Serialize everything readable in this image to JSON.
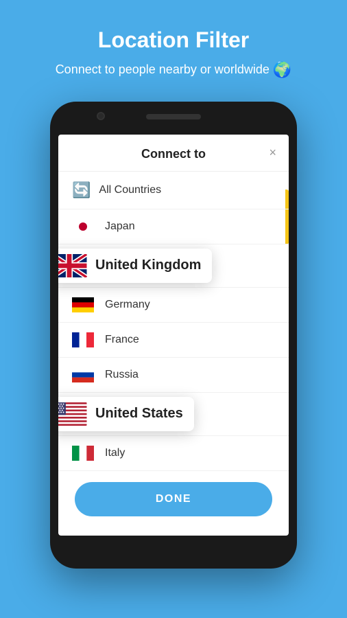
{
  "header": {
    "title": "Location Filter",
    "subtitle": "Connect to people nearby or\nworldwide",
    "globe_icon": "🌍"
  },
  "modal": {
    "title": "Connect to",
    "close_label": "×",
    "done_label": "DONE"
  },
  "countries": [
    {
      "id": "all",
      "name": "All Countries",
      "flag_type": "globe",
      "highlighted": false
    },
    {
      "id": "japan",
      "name": "Japan",
      "flag_type": "jp",
      "highlighted": false
    },
    {
      "id": "uk",
      "name": "United Kingdom",
      "flag_type": "uk",
      "highlighted": true
    },
    {
      "id": "germany",
      "name": "Germany",
      "flag_type": "de",
      "highlighted": false
    },
    {
      "id": "france",
      "name": "France",
      "flag_type": "fr",
      "highlighted": false
    },
    {
      "id": "russia",
      "name": "Russia",
      "flag_type": "ru",
      "highlighted": false
    },
    {
      "id": "us",
      "name": "United States",
      "flag_type": "us",
      "highlighted": true
    },
    {
      "id": "italy",
      "name": "Italy",
      "flag_type": "it",
      "highlighted": false
    }
  ]
}
